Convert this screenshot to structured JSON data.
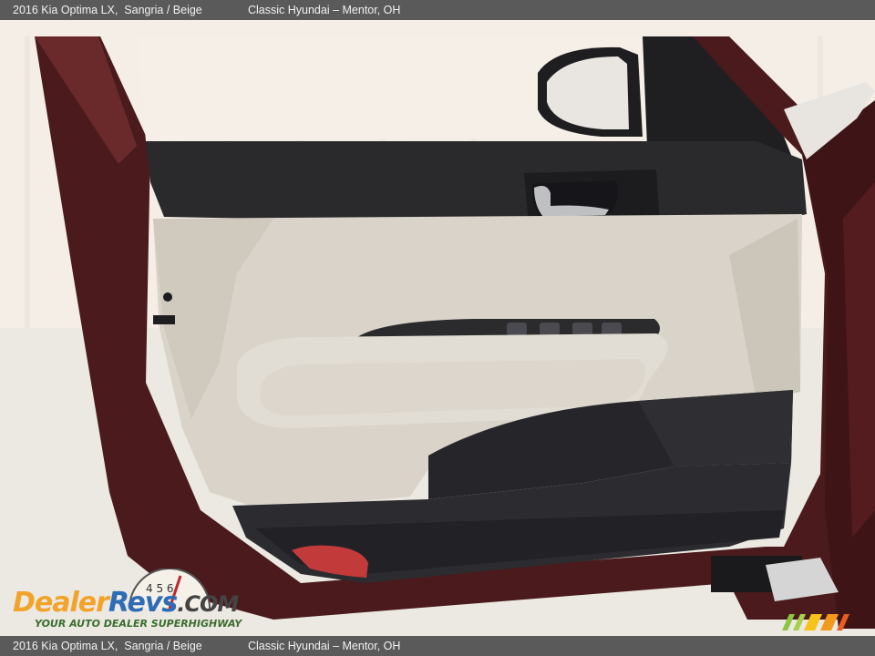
{
  "header": {
    "car_label": "2016 Kia Optima LX,  Sangria / Beige",
    "dealer_label": "Classic Hyundai – Mentor, OH"
  },
  "footer": {
    "car_label": "2016 Kia Optima LX,  Sangria / Beige",
    "dealer_label": "Classic Hyundai – Mentor, OH"
  },
  "photo": {
    "subject": "driver door interior panel",
    "colors": {
      "exterior_paint": "#4a1a1c",
      "trim_dark": "#2a2a2c",
      "panel_beige": "#d9d3c9",
      "armrest": "#e2ddd4",
      "background": "#f3ede5",
      "red_reflector": "#c23a3a"
    }
  },
  "watermark": {
    "brand_part1": "Dealer",
    "brand_part2": "Revs",
    "brand_suffix": ".COM",
    "tagline": "YOUR AUTO DEALER SUPERHIGHWAY",
    "gauge_digits": "4 5 6",
    "corner_logo": "mm-logo"
  }
}
